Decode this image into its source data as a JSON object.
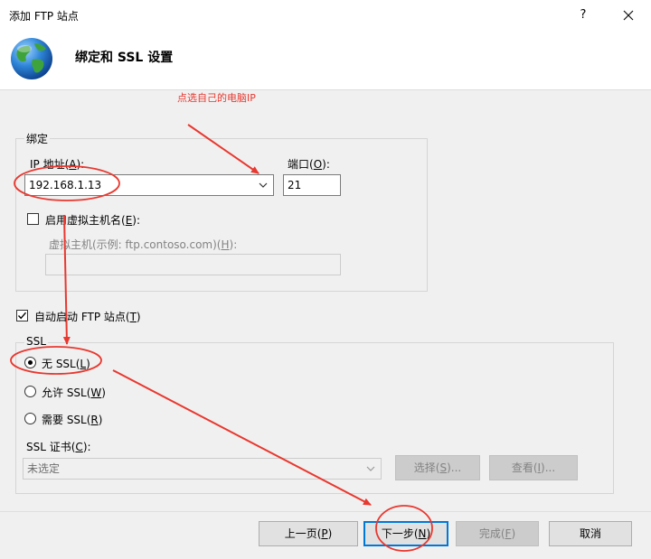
{
  "window": {
    "title": "添加 FTP 站点",
    "help_label": "?"
  },
  "header": {
    "title": "绑定和 SSL 设置"
  },
  "annotation": {
    "text": "点选自己的电脑IP",
    "color": "#e8382f"
  },
  "binding": {
    "group_label": "绑定",
    "ip_label_pre": "IP 地址(",
    "ip_label_key": "A",
    "ip_label_post": "):",
    "ip_value": "192.168.1.13",
    "port_label_pre": "端口(",
    "port_label_key": "O",
    "port_label_post": "):",
    "port_value": "21",
    "virtual_host_label_pre": "启用虚拟主机名(",
    "virtual_host_label_key": "E",
    "virtual_host_label_post": "):",
    "virtual_host_checked": false,
    "virtual_host_field_label_pre": "虚拟主机(示例: ftp.contoso.com)(",
    "virtual_host_field_label_key": "H",
    "virtual_host_field_label_post": "):",
    "virtual_host_value": ""
  },
  "autostart": {
    "label_pre": "自动启动 FTP 站点(",
    "label_key": "T",
    "label_post": ")",
    "checked": true
  },
  "ssl": {
    "group_label": "SSL",
    "options": [
      {
        "pre": "无 SSL(",
        "key": "L",
        "post": ")",
        "selected": true
      },
      {
        "pre": "允许 SSL(",
        "key": "W",
        "post": ")",
        "selected": false
      },
      {
        "pre": "需要 SSL(",
        "key": "R",
        "post": ")",
        "selected": false
      }
    ],
    "cert_label_pre": "SSL 证书(",
    "cert_label_key": "C",
    "cert_label_post": "):",
    "cert_value": "未选定",
    "select_button": {
      "pre": "选择(",
      "key": "S",
      "post": ")..."
    },
    "view_button": {
      "pre": "查看(",
      "key": "I",
      "post": ")..."
    }
  },
  "footer": {
    "prev": {
      "pre": "上一页(",
      "key": "P",
      "post": ")"
    },
    "next": {
      "pre": "下一步(",
      "key": "N",
      "post": ")"
    },
    "finish": {
      "pre": "完成(",
      "key": "F",
      "post": ")"
    },
    "cancel": "取消"
  }
}
